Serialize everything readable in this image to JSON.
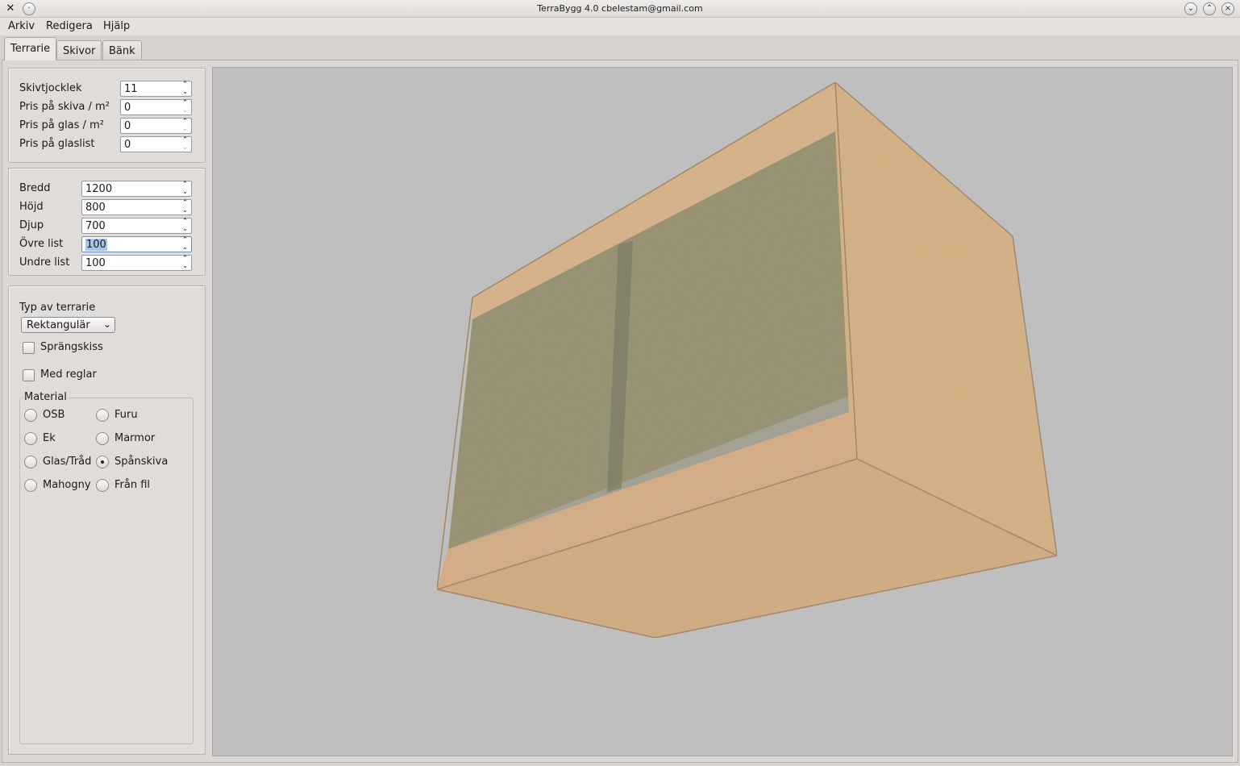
{
  "window": {
    "title": "TerraBygg 4.0 cbelestam@gmail.com",
    "app_icon": "crossed-tools-icon",
    "controls": [
      "minimize-icon",
      "maximize-icon",
      "close-icon"
    ]
  },
  "menu": {
    "items": [
      "Arkiv",
      "Redigera",
      "Hjälp"
    ]
  },
  "tabs": [
    "Terrarie",
    "Skivor",
    "Bänk"
  ],
  "pricing": {
    "skivtjocklek": {
      "label": "Skivtjocklek",
      "value": "11"
    },
    "pris_skiva": {
      "label": "Pris på skiva / m²",
      "value": "0"
    },
    "pris_glas": {
      "label": "Pris på glas / m²",
      "value": "0"
    },
    "pris_glaslist": {
      "label": "Pris på glaslist",
      "value": "0"
    }
  },
  "dimensions": {
    "bredd": {
      "label": "Bredd",
      "value": "1200"
    },
    "hojd": {
      "label": "Höjd",
      "value": "800"
    },
    "djup": {
      "label": "Djup",
      "value": "700"
    },
    "ovre_list": {
      "label": "Övre list",
      "value": "100"
    },
    "undre_list": {
      "label": "Undre list",
      "value": "100"
    }
  },
  "options": {
    "typ_label": "Typ av terrarie",
    "typ_value": "Rektangulär",
    "sprangskiss": "Sprängskiss",
    "med_reglar": "Med reglar",
    "material_title": "Material",
    "materials": [
      "OSB",
      "Furu",
      "Ek",
      "Marmor",
      "Glas/Tråd",
      "Spånskiva",
      "Mahogny",
      "Från fil"
    ],
    "selected_material": "Spånskiva"
  },
  "colors": {
    "viewport_bg": "#bfbfbf",
    "wood": "#d8b389",
    "glass": "#9e9a7e"
  }
}
